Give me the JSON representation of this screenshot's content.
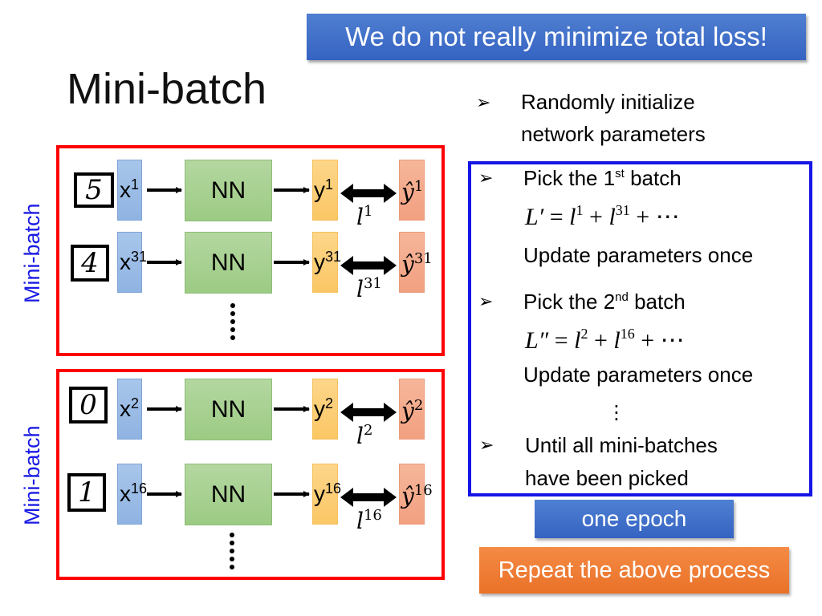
{
  "banner": {
    "text": "We do not really minimize total loss!"
  },
  "title": "Mini-batch",
  "side_labels": [
    "Mini-batch",
    "Mini-batch"
  ],
  "colors": {
    "banner_blue": "#3f6fc8",
    "minibatch_border": "#ff0000",
    "steps_border": "#1515e6",
    "side_label": "#1a1ae6",
    "x_box": "#9bbce6",
    "nn_box": "#a8d290",
    "y_box": "#fccf76",
    "yhat_box": "#f4ab8c",
    "repeat_orange": "#ee7a32"
  },
  "diagram": {
    "nn_label": "NN",
    "minibatches": [
      {
        "rows": [
          {
            "digit": "5",
            "x": "x",
            "sup": "1",
            "y": "y",
            "yhat": "ŷ",
            "loss": "l"
          },
          {
            "digit": "4",
            "x": "x",
            "sup": "31",
            "y": "y",
            "yhat": "ŷ",
            "loss": "l"
          }
        ]
      },
      {
        "rows": [
          {
            "digit": "0",
            "x": "x",
            "sup": "2",
            "y": "y",
            "yhat": "ŷ",
            "loss": "l"
          },
          {
            "digit": "1",
            "x": "x",
            "sup": "16",
            "y": "y",
            "yhat": "ŷ",
            "loss": "l"
          }
        ]
      }
    ]
  },
  "steps": {
    "init": {
      "line1": "Randomly initialize",
      "line2": "network parameters"
    },
    "first": {
      "text": "Pick the 1",
      "ordinal": "st",
      "suffix": " batch",
      "eq": {
        "lhs": "L′",
        "t1": "1",
        "t2": "31"
      },
      "update": "Update parameters once"
    },
    "second": {
      "text": "Pick the 2",
      "ordinal": "nd",
      "suffix": " batch",
      "eq": {
        "lhs": "L″",
        "t1": "2",
        "t2": "16"
      },
      "update": "Update parameters once"
    },
    "ellipsis": "⋮",
    "until": {
      "line1": "Until all mini-batches",
      "line2": "have been picked"
    }
  },
  "eq_symbols": {
    "eq": " = ",
    "l": "l",
    "plus": " + ",
    "dots": " ⋯"
  },
  "bullet_icon": "➢",
  "epoch_label": "one epoch",
  "repeat_label": "Repeat the above process"
}
